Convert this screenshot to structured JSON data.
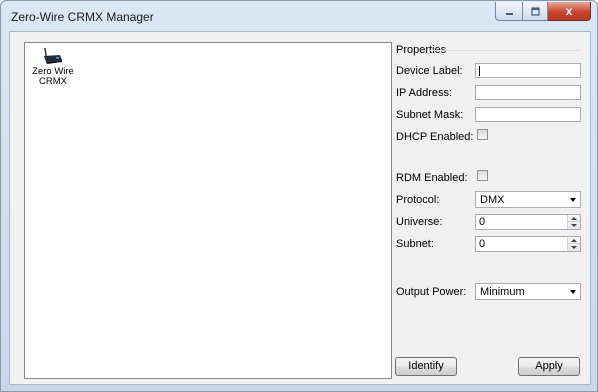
{
  "window": {
    "title": "Zero-Wire CRMX Manager",
    "close_glyph": "x"
  },
  "devices": [
    {
      "label_line1": "Zero Wire",
      "label_line2": "CRMX",
      "icon": "wireless-transmitter-icon"
    }
  ],
  "properties": {
    "title": "Properties",
    "device_label": {
      "label": "Device Label:",
      "value": ""
    },
    "ip_address": {
      "label": "IP Address:",
      "value": ""
    },
    "subnet_mask": {
      "label": "Subnet Mask:",
      "value": ""
    },
    "dhcp_enabled": {
      "label": "DHCP Enabled:",
      "checked": false
    },
    "rdm_enabled": {
      "label": "RDM Enabled:",
      "checked": false
    },
    "protocol": {
      "label": "Protocol:",
      "value": "DMX"
    },
    "universe": {
      "label": "Universe:",
      "value": "0"
    },
    "subnet": {
      "label": "Subnet:",
      "value": "0"
    },
    "output_power": {
      "label": "Output Power:",
      "value": "Minimum"
    }
  },
  "buttons": {
    "identify": "Identify",
    "apply": "Apply"
  },
  "colors": {
    "titlebar": "#dbe7f4",
    "close_button": "#c8452e",
    "panel": "#f0f0f0"
  }
}
